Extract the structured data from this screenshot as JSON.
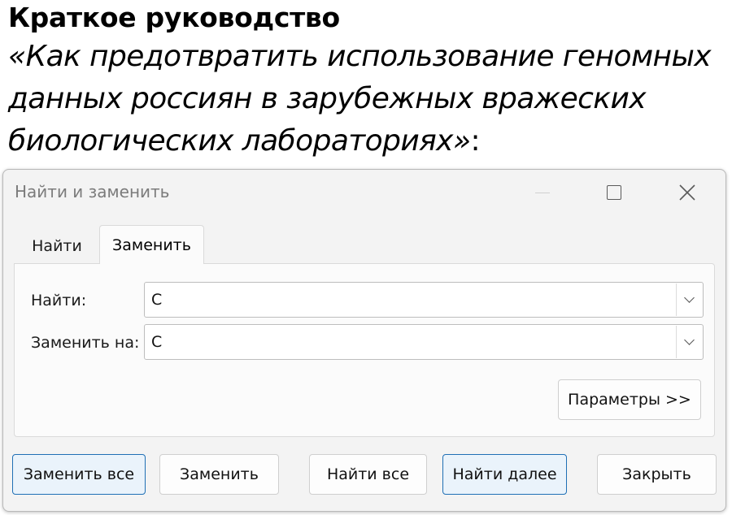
{
  "caption": {
    "title": "Краткое руководство",
    "line1": "«Как предотвратить использование геномных",
    "line2": "данных россиян в зарубежных вражеских",
    "line3": "биологических лабораториях»",
    "line3_suffix": ":"
  },
  "dialog": {
    "title": "Найти и заменить",
    "window_icons": [
      "minimize-icon",
      "maximize-icon",
      "close-icon"
    ],
    "tabs": [
      {
        "label": "Найти",
        "active": false
      },
      {
        "label": "Заменить",
        "active": true
      }
    ],
    "find_label": "Найти:",
    "find_value": "С",
    "replace_label": "Заменить на:",
    "replace_value": "C",
    "params_button": "Параметры >>",
    "buttons": {
      "replace_all": "Заменить все",
      "replace": "Заменить",
      "find_all": "Найти все",
      "find_next": "Найти далее",
      "close": "Закрыть"
    },
    "colors": {
      "accent": "#1f6fb5",
      "dialog_bg": "#f3f3f3",
      "title_text": "#7b7b7b"
    }
  }
}
